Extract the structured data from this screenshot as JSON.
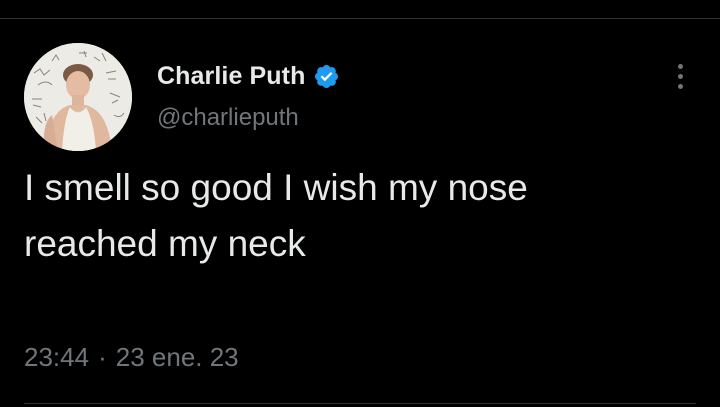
{
  "tweet": {
    "author": {
      "display_name": "Charlie Puth",
      "handle": "@charlieputh",
      "verified": true,
      "verified_badge_color": "#1d9bf0"
    },
    "text_lines": [
      "I smell so good I wish my nose",
      "reached my neck"
    ],
    "time": "23:44",
    "separator": "·",
    "date": "23 ene. 23"
  },
  "theme": {
    "background": "#000000",
    "primary_text": "#e7e9ea",
    "secondary_text": "#71767b",
    "divider": "#2f3336"
  },
  "icons": {
    "more": "more-vertical-icon",
    "verified": "verified-badge-icon"
  }
}
